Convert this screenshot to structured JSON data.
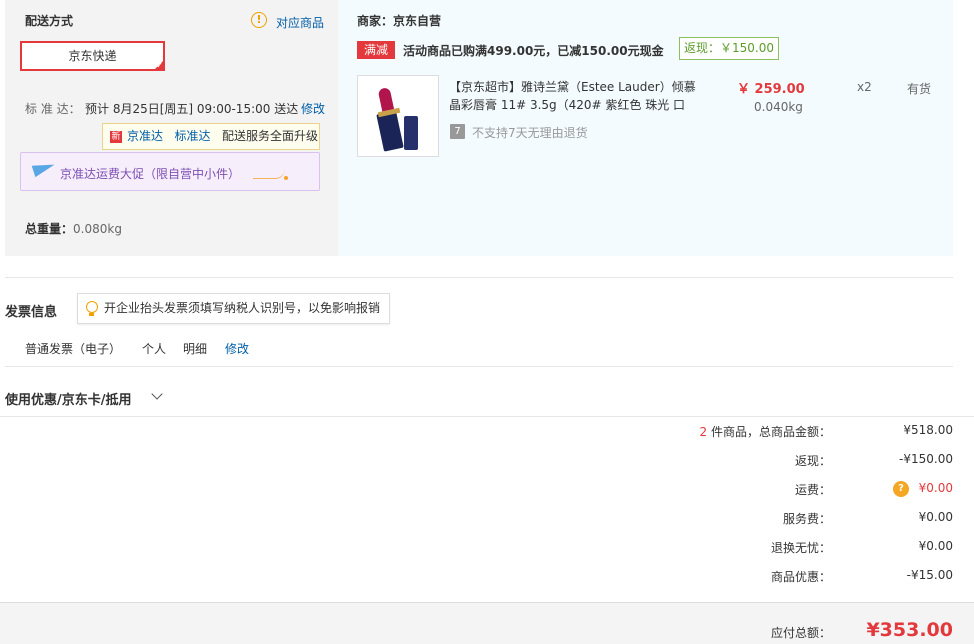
{
  "delivery": {
    "title": "配送方式",
    "match_link": "对应商品",
    "method": "京东快递",
    "standard_label": "标 准 达：",
    "standard_time": "预计 8月25日[周五] 09:00-15:00 送达",
    "modify": "修改",
    "tip": {
      "badge": "新",
      "brand1": "京准达",
      "brand2": "标准达",
      "rest": "配送服务全面升级"
    },
    "promo": "京准达运费大促（限自营中小件）",
    "weight_label": "总重量：",
    "weight_value": "0.080kg"
  },
  "shop": {
    "seller_label": "商家：",
    "seller_name": "京东自营",
    "full_badge": "满减",
    "promo_text": "活动商品已购满499.00元，已减150.00元现金",
    "rebate": "返现：￥150.00",
    "product": {
      "name_line1": "【京东超市】雅诗兰黛（Estee Lauder）倾慕",
      "name_line2": "晶彩唇膏 11# 3.5g（420# 紫红色 珠光 口",
      "price": "￥ 259.00",
      "weight": "0.040kg",
      "qty": "x2",
      "stock": "有货",
      "return_icon": "7",
      "return_text": "不支持7天无理由退货"
    }
  },
  "invoice": {
    "title": "发票信息",
    "tip": "开企业抬头发票须填写纳税人识别号，以免影响报销",
    "type": "普通发票（电子）",
    "personal": "个人",
    "detail": "明细",
    "modify": "修改"
  },
  "coupon": {
    "title": "使用优惠/京东卡/抵用"
  },
  "summary": {
    "count": "2",
    "count_suffix": " 件商品，总商品金额：",
    "goods_total": "¥518.00",
    "rebate_label": "返现：",
    "rebate_value": "-¥150.00",
    "shipping_label": "运费：",
    "shipping_icon": "?",
    "shipping_value": "¥0.00",
    "service_label": "服务费：",
    "service_value": "¥0.00",
    "return_label": "退换无忧：",
    "return_value": "¥0.00",
    "discount_label": "商品优惠：",
    "discount_value": "-¥15.00",
    "total_label": "应付总额：",
    "total_value": "¥353.00"
  },
  "colors": {
    "accent": "#e4393c",
    "link": "#005ea7",
    "panel_delivery": "#f3f3f3",
    "panel_shop": "#f3fbfe"
  }
}
